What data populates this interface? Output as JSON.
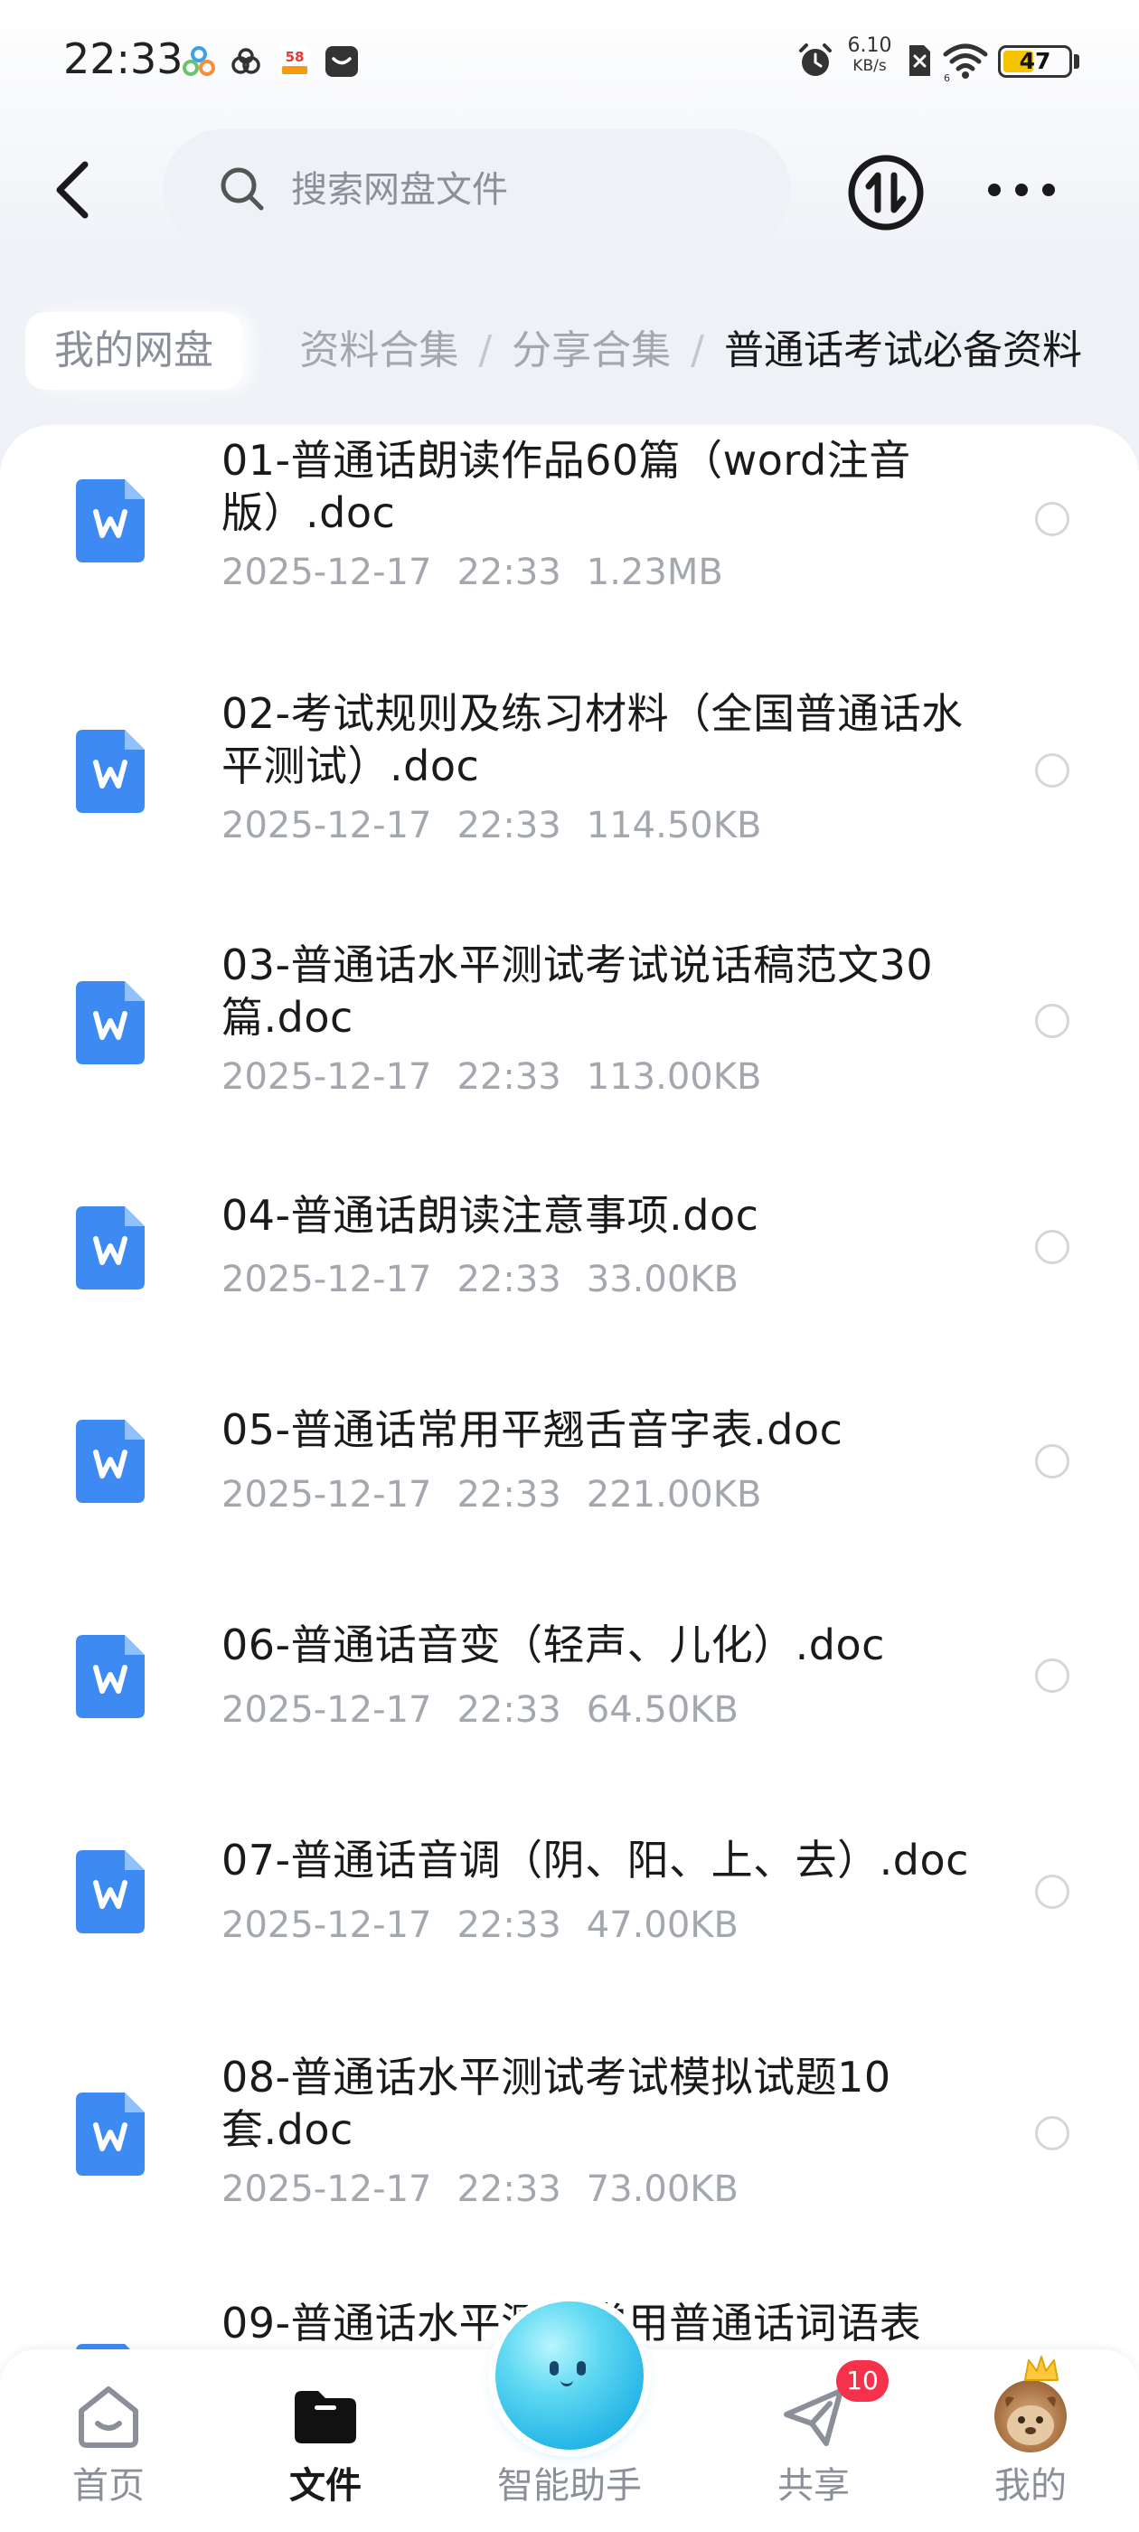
{
  "status_bar": {
    "time": "22:33",
    "net_speed_value": "6.10",
    "net_speed_unit": "KB/s",
    "battery_level": "47",
    "app_icons": [
      "cluster-app-icon",
      "cloud-app-icon",
      "58-app-icon",
      "message-app-icon"
    ],
    "right_icons": [
      "alarm-icon",
      "sim-off-icon",
      "wifi-icon",
      "battery-icon"
    ]
  },
  "header": {
    "search_placeholder": "搜索网盘文件",
    "icons": [
      "back-chevron-icon",
      "search-icon",
      "transfer-icon",
      "more-dots-icon"
    ]
  },
  "breadcrumb": {
    "home": "我的网盘",
    "items": [
      "资料合集",
      "分享合集"
    ],
    "current": "普通话考试必备资料",
    "separator": "/"
  },
  "files": [
    {
      "name": "01-普通话朗读作品60篇（word注音版）.doc",
      "date": "2025-12-17",
      "time": "22:33",
      "size": "1.23MB"
    },
    {
      "name": "02-考试规则及练习材料（全国普通话水平测试）.doc",
      "date": "2025-12-17",
      "time": "22:33",
      "size": "114.50KB"
    },
    {
      "name": "03-普通话水平测试考试说话稿范文30篇.doc",
      "date": "2025-12-17",
      "time": "22:33",
      "size": "113.00KB"
    },
    {
      "name": "04-普通话朗读注意事项.doc",
      "date": "2025-12-17",
      "time": "22:33",
      "size": "33.00KB"
    },
    {
      "name": "05-普通话常用平翘舌音字表.doc",
      "date": "2025-12-17",
      "time": "22:33",
      "size": "221.00KB"
    },
    {
      "name": "06-普通话音变（轻声、儿化）.doc",
      "date": "2025-12-17",
      "time": "22:33",
      "size": "64.50KB"
    },
    {
      "name": "07-普通话音调（阴、阳、上、去）.doc",
      "date": "2025-12-17",
      "time": "22:33",
      "size": "47.00KB"
    },
    {
      "name": "08-普通话水平测试考试模拟试题10套.doc",
      "date": "2025-12-17",
      "time": "22:33",
      "size": "73.00KB"
    },
    {
      "name": "09-普通话水平测试常用普通话词语表",
      "date": "",
      "time": "",
      "size": ""
    }
  ],
  "file_icon": "word-doc-icon",
  "bottom_nav": {
    "items": [
      {
        "label": "首页",
        "icon": "home-icon",
        "active": false
      },
      {
        "label": "文件",
        "icon": "folder-icon",
        "active": true
      },
      {
        "label": "智能助手",
        "icon": "assistant-orb-icon",
        "active": false
      },
      {
        "label": "共享",
        "icon": "share-plane-icon",
        "active": false
      },
      {
        "label": "我的",
        "icon": "avatar",
        "active": false
      }
    ],
    "share_badge": "10"
  },
  "colors": {
    "accent_blue": "#3d8bf2",
    "badge_red": "#f5314b",
    "battery_yellow": "#f5c400",
    "text_primary": "#1a1a1a",
    "text_secondary": "#a3a7ae",
    "search_bg": "#eef1f6"
  }
}
